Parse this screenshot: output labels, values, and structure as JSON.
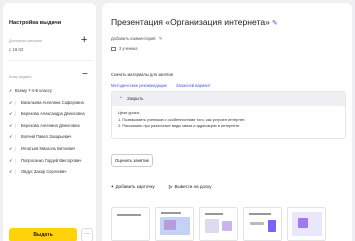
{
  "left_panel": {
    "title": "Настройка выдачи",
    "available_label": "Доступны начиная",
    "available_date": "с 19.02",
    "who_label": "Кому выдать",
    "assignees": [
      {
        "label": "Всему 7-л-Б классу",
        "checked": true
      },
      {
        "label": "Васильева Ангелина Саферовна",
        "checked": true
      },
      {
        "label": "Березова Александра Денисовна",
        "checked": true
      },
      {
        "label": "Березова Ангелина Денисовна",
        "checked": true
      },
      {
        "label": "Волчий Павел Захарьевич",
        "checked": true
      },
      {
        "label": "Игнатьев Михаэль Витоевич",
        "checked": true
      },
      {
        "label": "Попросанко Гордей Викторович",
        "checked": true
      },
      {
        "label": "Овдус Захар Сергеевич",
        "checked": true
      }
    ],
    "issue_button": "Выдать",
    "more_button": "···"
  },
  "main": {
    "title": "Презентация «Организация интернета»",
    "add_comment": "Добавить комментарий",
    "assignee_count": "3 ученика",
    "materials_label": "Скачать материалы для занятия",
    "links": [
      "Методические рекомендации",
      "Запасной вариант"
    ],
    "accordion": {
      "toggle_label": "Закрыть",
      "heading": "Цели урока:",
      "lines": [
        "1. Познакомить учеников с особенностями того, как устроен интернет.",
        "2. Рассказать про различные виды связи и адресацию в интернете."
      ]
    },
    "evaluate_button": "Оценить занятие",
    "add_card": "Добавить карточку",
    "show_on_board": "Вывести на доску"
  },
  "colors": {
    "accent_yellow": "#ffd20a",
    "link_blue": "#3b5bdb",
    "panel_bg": "#ffffff",
    "page_bg": "#f0f0f2"
  }
}
